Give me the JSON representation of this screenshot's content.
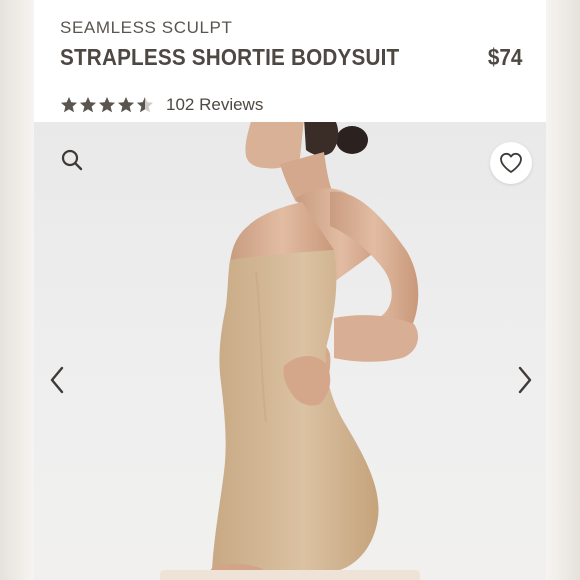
{
  "product": {
    "collection": "SEAMLESS SCULPT",
    "title": "STRAPLESS SHORTIE BODYSUIT",
    "price": "$74"
  },
  "rating": {
    "value": 4.5,
    "max": 5,
    "reviews_label": "102 Reviews"
  },
  "icons": {
    "search": "search-icon",
    "favorite": "heart-icon",
    "previous": "chevron-left-icon",
    "next": "chevron-right-icon"
  },
  "colors": {
    "text": "#4e4843",
    "star_filled": "#5b5550",
    "star_empty": "#cfcbc6",
    "garment": "#d6bb9a",
    "photo_bg": "#ececec"
  }
}
